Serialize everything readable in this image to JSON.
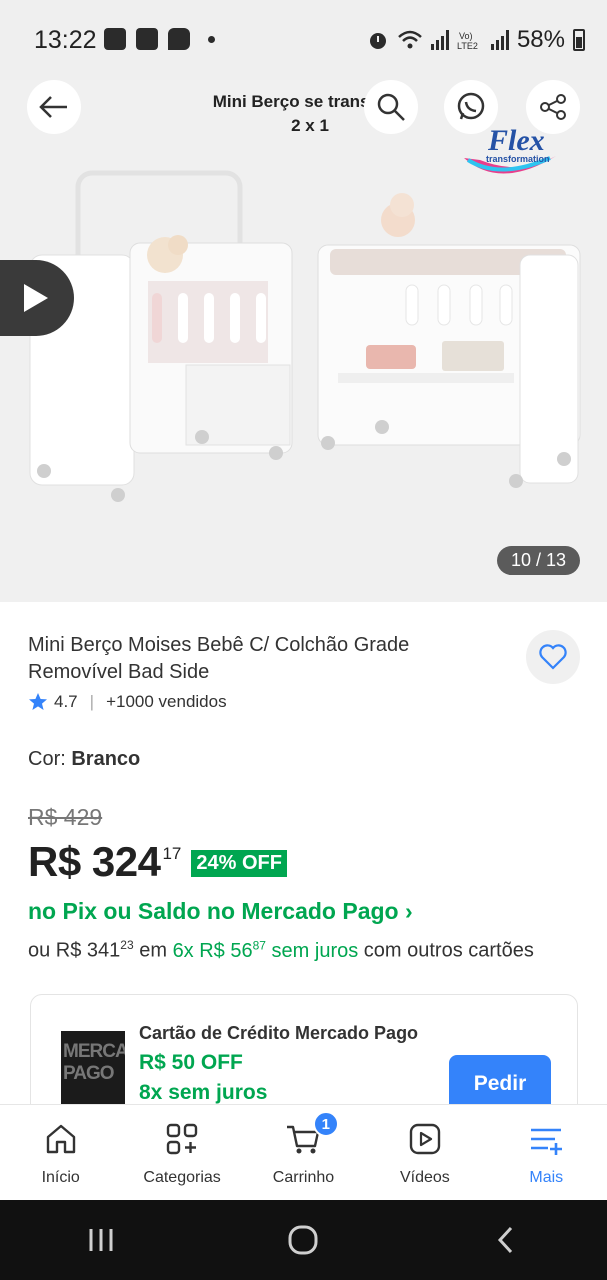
{
  "status_bar": {
    "time": "13:22",
    "battery": "58%"
  },
  "header": {
    "title": "Mini Berço se transform... troc... 2 x 1",
    "title_line1": "Mini Berço se transform",
    "title_line2": "2 x 1"
  },
  "hero": {
    "counter": "10 / 13",
    "logo_text": "Flex",
    "logo_sub": "transformation"
  },
  "product": {
    "title": "Mini Berço Moises Bebê C/ Colchão Grade Removível Bad Side",
    "rating": "4.7",
    "sold": "+1000 vendidos",
    "color_label": "Cor:",
    "color_value": "Branco",
    "old_price": "R$ 429",
    "price": "R$ 324",
    "price_cents": "17",
    "discount": "24% OFF",
    "pix_text": "no Pix ou Saldo no Mercado Pago ›",
    "install_prefix": "ou R$ 341",
    "install_prefix_cents": "23",
    "install_mid": " em ",
    "install_green": "6x R$ 56",
    "install_green_cents": "87",
    "install_green_tail": " sem juros",
    "install_suffix": " com outros cartões"
  },
  "card_promo": {
    "card_text": "MERCADO PAGO",
    "title": "Cartão de Crédito Mercado Pago",
    "off": "R$ 50 OFF",
    "installments": "8x sem juros",
    "button": "Pedir"
  },
  "bottom_nav": {
    "items": [
      {
        "label": "Início",
        "icon": "home-icon"
      },
      {
        "label": "Categorias",
        "icon": "categories-icon"
      },
      {
        "label": "Carrinho",
        "icon": "cart-icon",
        "badge": "1"
      },
      {
        "label": "Vídeos",
        "icon": "videos-icon"
      },
      {
        "label": "Mais",
        "icon": "more-icon"
      }
    ]
  },
  "colors": {
    "accent": "#3483fa",
    "green": "#00a650",
    "hero_bg": "#f0f0f0"
  }
}
